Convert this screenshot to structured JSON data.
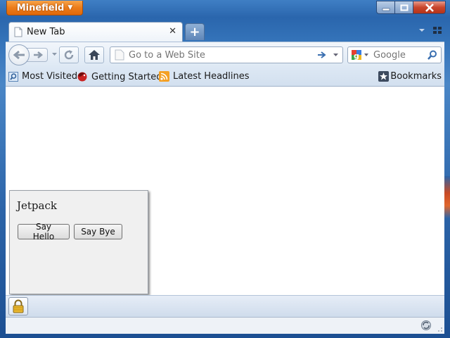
{
  "app": {
    "name": "Minefield"
  },
  "colors": {
    "app_button": "#ec7c1a",
    "window_frame": "#2a66ad",
    "toolbar": "#dde8f4",
    "panel_bg": "#f0f0f0"
  },
  "tabs": [
    {
      "label": "New Tab",
      "icon": "page-icon",
      "active": true
    }
  ],
  "toolbar": {
    "url": {
      "value": "",
      "placeholder": "Go to a Web Site"
    },
    "search": {
      "engine": "Google",
      "value": "",
      "placeholder": "Google"
    }
  },
  "bookmarks": {
    "items": [
      {
        "label": "Most Visited",
        "icon": "most-visited-icon"
      },
      {
        "label": "Getting Started",
        "icon": "firefox-icon"
      },
      {
        "label": "Latest Headlines",
        "icon": "rss-feed-icon"
      }
    ],
    "menu_label": "Bookmarks"
  },
  "panel": {
    "title": "Jetpack",
    "buttons": [
      {
        "label": "Say Hello"
      },
      {
        "label": "Say Bye"
      }
    ]
  }
}
